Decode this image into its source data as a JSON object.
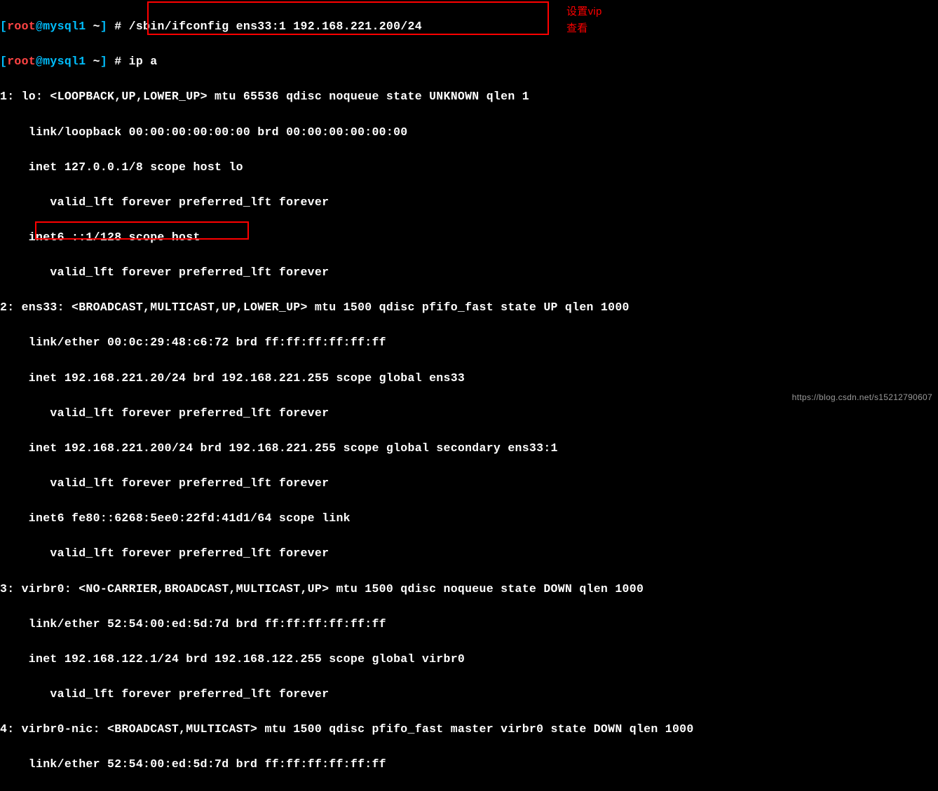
{
  "prompt": {
    "open_bracket": "[",
    "user": "root",
    "at": "@",
    "host": "mysql1",
    "space_tilde": " ~",
    "close_bracket": "]",
    "hash": " # "
  },
  "commands": {
    "cmd1": "/sbin/ifconfig ens33:1 192.168.221.200/24",
    "cmd2": "ip a"
  },
  "annotations": {
    "anno1": "设置vip",
    "anno2": "查看"
  },
  "output": {
    "l01": "1: lo: <LOOPBACK,UP,LOWER_UP> mtu 65536 qdisc noqueue state UNKNOWN qlen 1",
    "l02": "    link/loopback 00:00:00:00:00:00 brd 00:00:00:00:00:00",
    "l03": "    inet 127.0.0.1/8 scope host lo",
    "l04": "       valid_lft forever preferred_lft forever",
    "l05": "    inet6 ::1/128 scope host",
    "l06": "       valid_lft forever preferred_lft forever",
    "l07": "2: ens33: <BROADCAST,MULTICAST,UP,LOWER_UP> mtu 1500 qdisc pfifo_fast state UP qlen 1000",
    "l08": "    link/ether 00:0c:29:48:c6:72 brd ff:ff:ff:ff:ff:ff",
    "l09": "    inet 192.168.221.20/24 brd 192.168.221.255 scope global ens33",
    "l10": "       valid_lft forever preferred_lft forever",
    "l11": "    inet 192.168.221.200/24 brd 192.168.221.255 scope global secondary ens33:1",
    "l12": "       valid_lft forever preferred_lft forever",
    "l13": "    inet6 fe80::6268:5ee0:22fd:41d1/64 scope link",
    "l14": "       valid_lft forever preferred_lft forever",
    "l15": "3: virbr0: <NO-CARRIER,BROADCAST,MULTICAST,UP> mtu 1500 qdisc noqueue state DOWN qlen 1000",
    "l16": "    link/ether 52:54:00:ed:5d:7d brd ff:ff:ff:ff:ff:ff",
    "l17": "    inet 192.168.122.1/24 brd 192.168.122.255 scope global virbr0",
    "l18": "       valid_lft forever preferred_lft forever",
    "l19": "4: virbr0-nic: <BROADCAST,MULTICAST> mtu 1500 qdisc pfifo_fast master virbr0 state DOWN qlen 1000",
    "l20": "    link/ether 52:54:00:ed:5d:7d brd ff:ff:ff:ff:ff:ff"
  },
  "watermark": "https://blog.csdn.net/s15212790607"
}
